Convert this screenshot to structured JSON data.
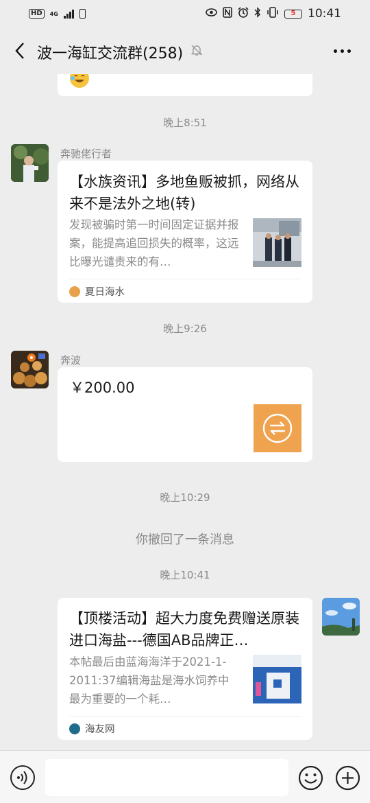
{
  "status_bar": {
    "hd": "HD",
    "network": "4G",
    "battery": "5",
    "time": "10:41"
  },
  "header": {
    "title": "波一海缸交流群(258)"
  },
  "messages": {
    "time_1": "晚上8:51",
    "msg_1": {
      "sender": "奔驰佬行者",
      "title": "【水族资讯】多地鱼贩被抓，网络从来不是法外之地(转)",
      "desc": "发现被骗时第一时间固定证据并报案，能提高追回损失的概率，这远比曝光谴责来的有…",
      "source": "夏日海水"
    },
    "time_2": "晚上9:26",
    "msg_2": {
      "sender": "奔波",
      "amount": "￥200.00"
    },
    "time_3": "晚上10:29",
    "recall": "你撤回了一条消息",
    "time_4": "晚上10:41",
    "msg_3": {
      "title": "【顶楼活动】超大力度免费赠送原装进口海盐---德国AB品牌正…",
      "desc": "本帖最后由蓝海海洋于2021-1-2011:37编辑海盐是海水饲养中最为重要的一个耗…",
      "source": "海友网"
    }
  },
  "input": {
    "placeholder": ""
  },
  "colors": {
    "background": "#ededed",
    "bubble": "#ffffff",
    "transfer_orange": "#f0a34f",
    "muted_text": "#8a8a8a"
  }
}
